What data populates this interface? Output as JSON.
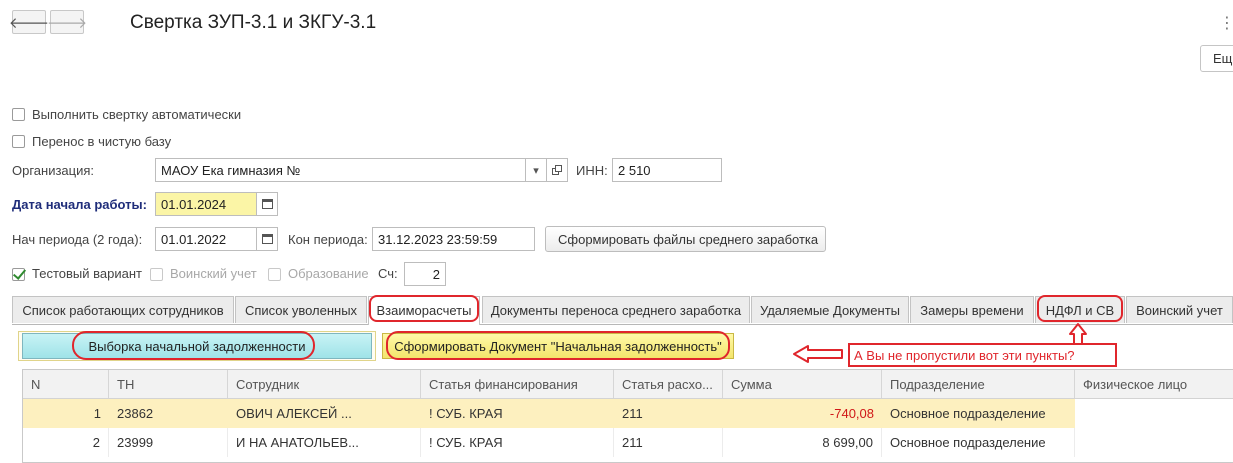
{
  "header": {
    "back_glyph": "🡐",
    "forward_glyph": "🡒",
    "title": "Свертка ЗУП-3.1 и ЗКГУ-3.1",
    "more_label": "Ещ",
    "menu_glyph": "⋮"
  },
  "options": {
    "auto_label": "Выполнить свертку автоматически",
    "clean_label": "Перенос в чистую базу"
  },
  "org": {
    "label": "Организация:",
    "value": "МАОУ Ека                гимназия №",
    "inn_label": "ИНН:",
    "inn_value": "2          510"
  },
  "start": {
    "label": "Дата начала работы:",
    "value": "01.01.2024"
  },
  "period": {
    "from_label": "Нач периода (2 года):",
    "from_value": "01.01.2022",
    "to_label": "Кон периода:",
    "to_value": "31.12.2023 23:59:59",
    "button": "Сформировать файлы среднего заработка"
  },
  "flags": {
    "test_label": "Тестовый вариант",
    "military_label": "Воинский учет",
    "education_label": "Образование",
    "counter_label": "Сч:",
    "counter_value": "2"
  },
  "tabs": [
    "Список работающих сотрудников",
    "Список уволенных",
    "Взаиморасчеты",
    "Документы переноса среднего заработка",
    "Удаляемые Документы",
    "Замеры времени",
    "НДФЛ и СВ",
    "Воинский учет"
  ],
  "actions": {
    "selection_button": "Выборка начальной задолженности",
    "create_button": "Сформировать Документ \"Начальная задолженность\""
  },
  "annotation": {
    "text": "А Вы не пропустили вот эти пункты?"
  },
  "table": {
    "columns": [
      "N",
      "ТН",
      "Сотрудник",
      "Статья финансирования",
      "Статья расхо...",
      "Сумма",
      "Подразделение",
      "Физическое лицо"
    ],
    "rows": [
      [
        "1",
        "23862",
        "                ОВИЧ АЛЕКСЕЙ ...",
        "! СУБ. КРАЯ",
        "211",
        "-740,08",
        "Основное подразделение",
        ""
      ],
      [
        "2",
        "23999",
        "    И     НА АНАТОЛЬЕВ...",
        "! СУБ. КРАЯ",
        "211",
        "8 699,00",
        "Основное подразделение",
        ""
      ]
    ]
  },
  "colors": {
    "accent_red": "#e0262c",
    "required_label": "#1f2d7a",
    "selected_row": "#fdf0bf"
  }
}
